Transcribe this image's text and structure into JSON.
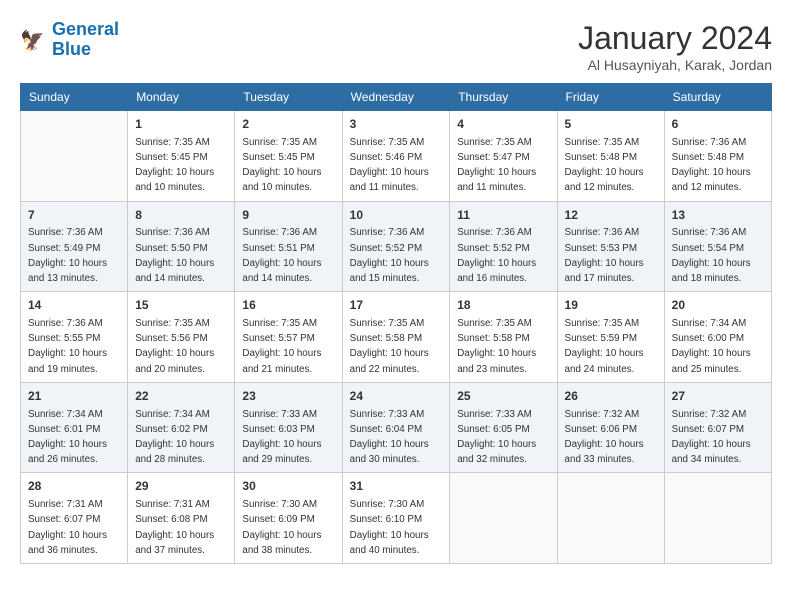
{
  "logo": {
    "line1": "General",
    "line2": "Blue"
  },
  "title": "January 2024",
  "location": "Al Husayniyah, Karak, Jordan",
  "headers": [
    "Sunday",
    "Monday",
    "Tuesday",
    "Wednesday",
    "Thursday",
    "Friday",
    "Saturday"
  ],
  "weeks": [
    [
      {
        "day": "",
        "info": ""
      },
      {
        "day": "1",
        "info": "Sunrise: 7:35 AM\nSunset: 5:45 PM\nDaylight: 10 hours\nand 10 minutes."
      },
      {
        "day": "2",
        "info": "Sunrise: 7:35 AM\nSunset: 5:45 PM\nDaylight: 10 hours\nand 10 minutes."
      },
      {
        "day": "3",
        "info": "Sunrise: 7:35 AM\nSunset: 5:46 PM\nDaylight: 10 hours\nand 11 minutes."
      },
      {
        "day": "4",
        "info": "Sunrise: 7:35 AM\nSunset: 5:47 PM\nDaylight: 10 hours\nand 11 minutes."
      },
      {
        "day": "5",
        "info": "Sunrise: 7:35 AM\nSunset: 5:48 PM\nDaylight: 10 hours\nand 12 minutes."
      },
      {
        "day": "6",
        "info": "Sunrise: 7:36 AM\nSunset: 5:48 PM\nDaylight: 10 hours\nand 12 minutes."
      }
    ],
    [
      {
        "day": "7",
        "info": "Sunrise: 7:36 AM\nSunset: 5:49 PM\nDaylight: 10 hours\nand 13 minutes."
      },
      {
        "day": "8",
        "info": "Sunrise: 7:36 AM\nSunset: 5:50 PM\nDaylight: 10 hours\nand 14 minutes."
      },
      {
        "day": "9",
        "info": "Sunrise: 7:36 AM\nSunset: 5:51 PM\nDaylight: 10 hours\nand 14 minutes."
      },
      {
        "day": "10",
        "info": "Sunrise: 7:36 AM\nSunset: 5:52 PM\nDaylight: 10 hours\nand 15 minutes."
      },
      {
        "day": "11",
        "info": "Sunrise: 7:36 AM\nSunset: 5:52 PM\nDaylight: 10 hours\nand 16 minutes."
      },
      {
        "day": "12",
        "info": "Sunrise: 7:36 AM\nSunset: 5:53 PM\nDaylight: 10 hours\nand 17 minutes."
      },
      {
        "day": "13",
        "info": "Sunrise: 7:36 AM\nSunset: 5:54 PM\nDaylight: 10 hours\nand 18 minutes."
      }
    ],
    [
      {
        "day": "14",
        "info": "Sunrise: 7:36 AM\nSunset: 5:55 PM\nDaylight: 10 hours\nand 19 minutes."
      },
      {
        "day": "15",
        "info": "Sunrise: 7:35 AM\nSunset: 5:56 PM\nDaylight: 10 hours\nand 20 minutes."
      },
      {
        "day": "16",
        "info": "Sunrise: 7:35 AM\nSunset: 5:57 PM\nDaylight: 10 hours\nand 21 minutes."
      },
      {
        "day": "17",
        "info": "Sunrise: 7:35 AM\nSunset: 5:58 PM\nDaylight: 10 hours\nand 22 minutes."
      },
      {
        "day": "18",
        "info": "Sunrise: 7:35 AM\nSunset: 5:58 PM\nDaylight: 10 hours\nand 23 minutes."
      },
      {
        "day": "19",
        "info": "Sunrise: 7:35 AM\nSunset: 5:59 PM\nDaylight: 10 hours\nand 24 minutes."
      },
      {
        "day": "20",
        "info": "Sunrise: 7:34 AM\nSunset: 6:00 PM\nDaylight: 10 hours\nand 25 minutes."
      }
    ],
    [
      {
        "day": "21",
        "info": "Sunrise: 7:34 AM\nSunset: 6:01 PM\nDaylight: 10 hours\nand 26 minutes."
      },
      {
        "day": "22",
        "info": "Sunrise: 7:34 AM\nSunset: 6:02 PM\nDaylight: 10 hours\nand 28 minutes."
      },
      {
        "day": "23",
        "info": "Sunrise: 7:33 AM\nSunset: 6:03 PM\nDaylight: 10 hours\nand 29 minutes."
      },
      {
        "day": "24",
        "info": "Sunrise: 7:33 AM\nSunset: 6:04 PM\nDaylight: 10 hours\nand 30 minutes."
      },
      {
        "day": "25",
        "info": "Sunrise: 7:33 AM\nSunset: 6:05 PM\nDaylight: 10 hours\nand 32 minutes."
      },
      {
        "day": "26",
        "info": "Sunrise: 7:32 AM\nSunset: 6:06 PM\nDaylight: 10 hours\nand 33 minutes."
      },
      {
        "day": "27",
        "info": "Sunrise: 7:32 AM\nSunset: 6:07 PM\nDaylight: 10 hours\nand 34 minutes."
      }
    ],
    [
      {
        "day": "28",
        "info": "Sunrise: 7:31 AM\nSunset: 6:07 PM\nDaylight: 10 hours\nand 36 minutes."
      },
      {
        "day": "29",
        "info": "Sunrise: 7:31 AM\nSunset: 6:08 PM\nDaylight: 10 hours\nand 37 minutes."
      },
      {
        "day": "30",
        "info": "Sunrise: 7:30 AM\nSunset: 6:09 PM\nDaylight: 10 hours\nand 38 minutes."
      },
      {
        "day": "31",
        "info": "Sunrise: 7:30 AM\nSunset: 6:10 PM\nDaylight: 10 hours\nand 40 minutes."
      },
      {
        "day": "",
        "info": ""
      },
      {
        "day": "",
        "info": ""
      },
      {
        "day": "",
        "info": ""
      }
    ]
  ]
}
